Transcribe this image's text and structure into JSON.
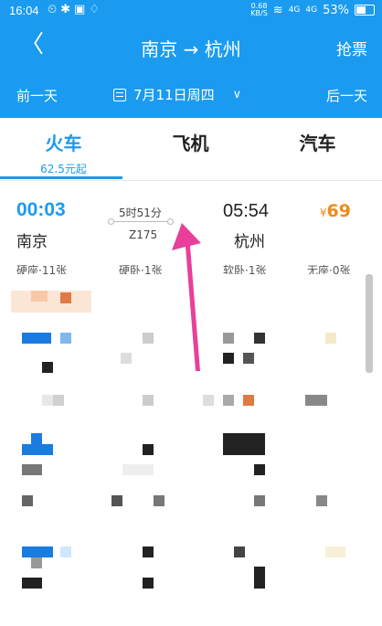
{
  "status_bar": {
    "time": "16:04",
    "net_speed_top": "0.68",
    "net_speed_bottom": "KB/S",
    "signal1": "4G",
    "signal2": "4G",
    "battery": "53%"
  },
  "nav": {
    "back_glyph": "〈",
    "route": "南京 → 杭州",
    "right_action": "抢票"
  },
  "date_bar": {
    "prev": "前一天",
    "date": "7月11日周四",
    "chevron": "∨",
    "next": "后一天"
  },
  "tabs": [
    {
      "label": "火车",
      "sub": "62.5元起",
      "active": true
    },
    {
      "label": "飞机",
      "sub": ""
    },
    {
      "label": "汽车",
      "sub": ""
    }
  ],
  "train": {
    "depart_time": "00:03",
    "depart_station": "南京",
    "duration": "5时51分",
    "train_no": "Z175",
    "arrive_time": "05:54",
    "arrive_station": "杭州",
    "price_symbol": "¥",
    "price": "69",
    "seats": [
      "硬座·11张",
      "硬卧·1张",
      "软卧·1张",
      "无座·0张"
    ]
  },
  "colors": {
    "primary": "#1a9bf0",
    "price": "#f08b1b",
    "annotation": "#e8409a"
  },
  "icons": [
    "back-icon",
    "calendar-icon",
    "chevron-down-icon",
    "battery-icon",
    "wifi-icon"
  ]
}
